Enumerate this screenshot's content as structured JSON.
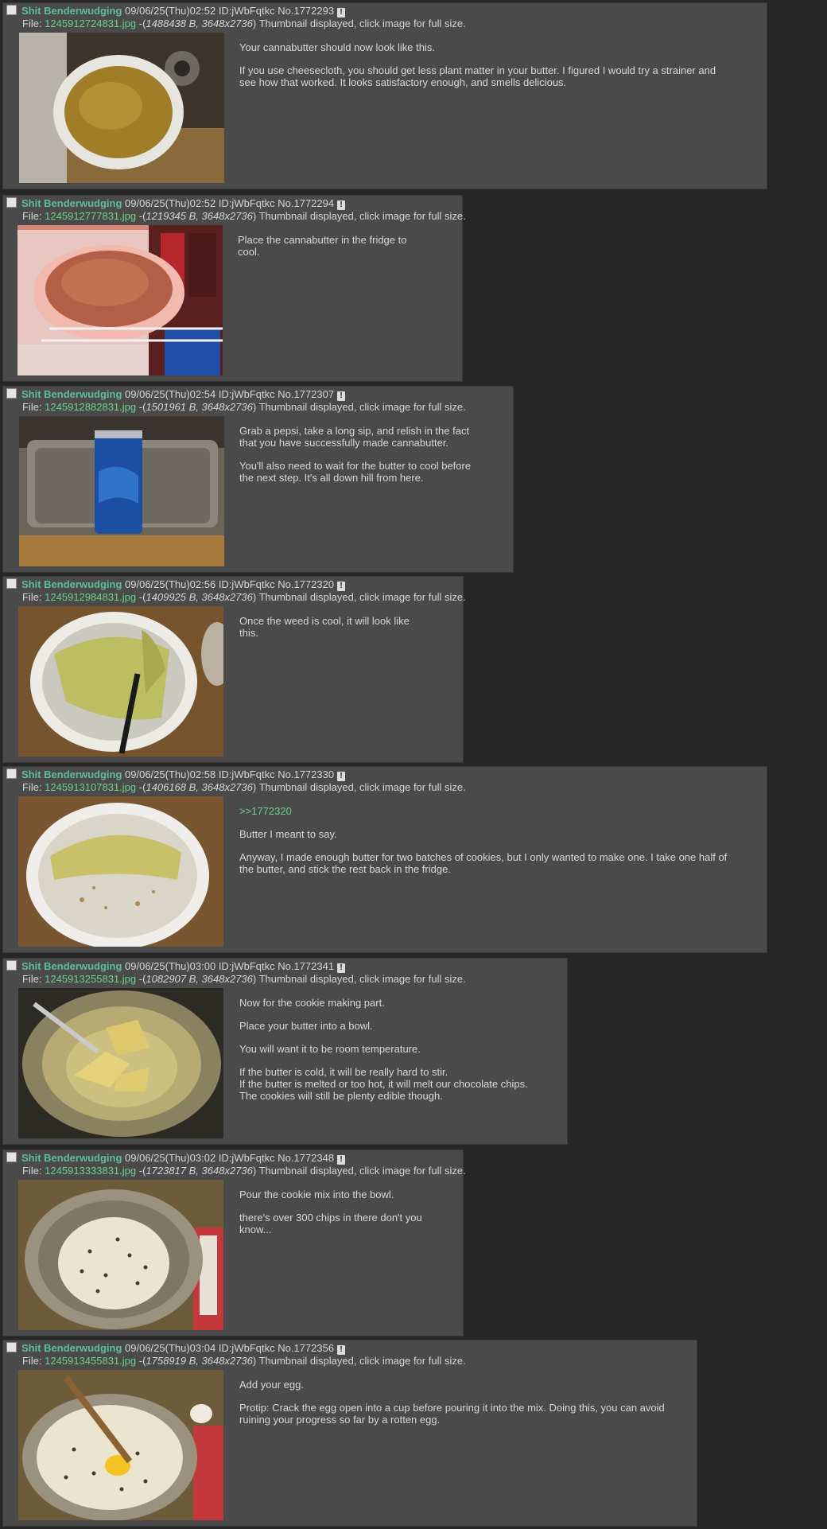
{
  "posts": [
    {
      "name": "Shit Benderwudging",
      "meta": "09/06/25(Thu)02:52 ID:jWbFqtkc No.1772293",
      "report_icon": "!",
      "file_prefix": "File: ",
      "file_name": "1245912724831.jpg",
      "file_sep": " -(",
      "file_meta": "1488438 B, 3648x2736",
      "file_suffix": ") Thumbnail displayed, click image for full size.",
      "thumb_icon": "bowl-cannabutter-image",
      "body": [
        "Your cannabutter should now look like this.",
        "If you use cheesecloth, you should get less plant matter in your butter. I figured I would try a strainer and see how that worked. It looks satisfactory enough, and smells delicious."
      ]
    },
    {
      "name": "Shit Benderwudging",
      "meta": "09/06/25(Thu)02:52 ID:jWbFqtkc No.1772294",
      "report_icon": "!",
      "file_prefix": "File: ",
      "file_name": "1245912777831.jpg",
      "file_sep": " -(",
      "file_meta": "1219345 B, 3648x2736",
      "file_suffix": ") Thumbnail displayed, click image for full size.",
      "thumb_icon": "fridge-bowl-image",
      "body": [
        "Place the cannabutter in the fridge to cool."
      ]
    },
    {
      "name": "Shit Benderwudging",
      "meta": "09/06/25(Thu)02:54 ID:jWbFqtkc No.1772307",
      "report_icon": "!",
      "file_prefix": "File: ",
      "file_name": "1245912882831.jpg",
      "file_sep": " -(",
      "file_meta": "1501961 B, 3648x2736",
      "file_suffix": ") Thumbnail displayed, click image for full size.",
      "thumb_icon": "pepsi-can-sink-image",
      "body": [
        "Grab a pepsi, take a long sip, and relish in the fact that you have successfully made cannabutter.",
        "You'll also need to wait for the butter to cool before the next step. It's all down hill from here."
      ]
    },
    {
      "name": "Shit Benderwudging",
      "meta": "09/06/25(Thu)02:56 ID:jWbFqtkc No.1772320",
      "report_icon": "!",
      "file_prefix": "File: ",
      "file_name": "1245912984831.jpg",
      "file_sep": " -(",
      "file_meta": "1409925 B, 3648x2736",
      "file_suffix": ") Thumbnail displayed, click image for full size.",
      "thumb_icon": "cooled-butter-knife-image",
      "body": [
        "Once the weed is cool, it will look like this."
      ]
    },
    {
      "name": "Shit Benderwudging",
      "meta": "09/06/25(Thu)02:58 ID:jWbFqtkc No.1772330",
      "report_icon": "!",
      "file_prefix": "File: ",
      "file_name": "1245913107831.jpg",
      "file_sep": " -(",
      "file_meta": "1406168 B, 3648x2736",
      "file_suffix": ") Thumbnail displayed, click image for full size.",
      "thumb_icon": "half-butter-bowl-image",
      "quote": ">>1772320",
      "body": [
        "Butter I meant to say.",
        "Anyway, I made enough butter for two batches of cookies, but I only wanted to make one. I take one half of the butter, and stick the rest back in the fridge."
      ]
    },
    {
      "name": "Shit Benderwudging",
      "meta": "09/06/25(Thu)03:00 ID:jWbFqtkc No.1772341",
      "report_icon": "!",
      "file_prefix": "File: ",
      "file_name": "1245913255831.jpg",
      "file_sep": " -(",
      "file_meta": "1082907 B, 3648x2736",
      "file_suffix": ") Thumbnail displayed, click image for full size.",
      "thumb_icon": "butter-in-metal-bowl-image",
      "body": [
        "Now for the cookie making part.",
        "Place your butter into a bowl.",
        "You will want it to be room temperature.",
        "If the butter is cold, it will be really hard to stir.\nIf the butter is melted or too hot, it will melt our chocolate chips.\nThe cookies will still be plenty edible though."
      ]
    },
    {
      "name": "Shit Benderwudging",
      "meta": "09/06/25(Thu)03:02 ID:jWbFqtkc No.1772348",
      "report_icon": "!",
      "file_prefix": "File: ",
      "file_name": "1245913333831.jpg",
      "file_sep": " -(",
      "file_meta": "1723817 B, 3648x2736",
      "file_suffix": ") Thumbnail displayed, click image for full size.",
      "thumb_icon": "cookie-mix-bowl-image",
      "body": [
        "Pour the cookie mix into the bowl.",
        "there's over 300 chips in there don't you know..."
      ]
    },
    {
      "name": "Shit Benderwudging",
      "meta": "09/06/25(Thu)03:04 ID:jWbFqtkc No.1772356",
      "report_icon": "!",
      "file_prefix": "File: ",
      "file_name": "1245913455831.jpg",
      "file_sep": " -(",
      "file_meta": "1758919 B, 3648x2736",
      "file_suffix": ") Thumbnail displayed, click image for full size.",
      "thumb_icon": "egg-in-mix-image",
      "body": [
        "Add your egg.",
        "Protip: Crack the egg open into a cup before pouring it into the mix. Doing this, you can avoid ruining your progress so far by a rotten egg."
      ]
    }
  ]
}
